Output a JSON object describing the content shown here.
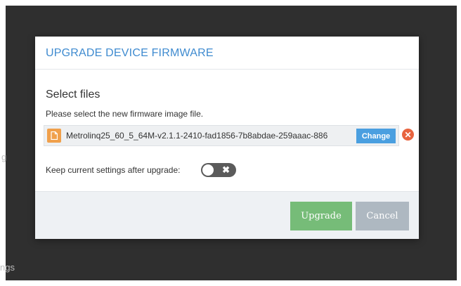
{
  "background": {
    "fragment_1": "g",
    "fragment_2": "ngs"
  },
  "dialog": {
    "title": "UPGRADE DEVICE FIRMWARE",
    "section_title": "Select files",
    "instruction": "Please select the new firmware image file.",
    "file": {
      "icon": "file-icon",
      "name": "Metrolinq25_60_5_64M-v2.1.1-2410-fad1856-7b8abdae-259aaac-886",
      "change_label": "Change",
      "remove_icon": "close-circle-icon"
    },
    "keep_settings": {
      "label": "Keep current settings after upgrade:",
      "toggle_state": "off",
      "toggle_symbol": "✖"
    },
    "buttons": {
      "upgrade": "Upgrade",
      "cancel": "Cancel"
    },
    "colors": {
      "title": "#3f8bd0",
      "change": "#4a9fe0",
      "remove": "#e8643f",
      "upgrade": "#76bc78",
      "cancel": "#aeb8c1",
      "file_icon": "#f0a04b"
    }
  }
}
